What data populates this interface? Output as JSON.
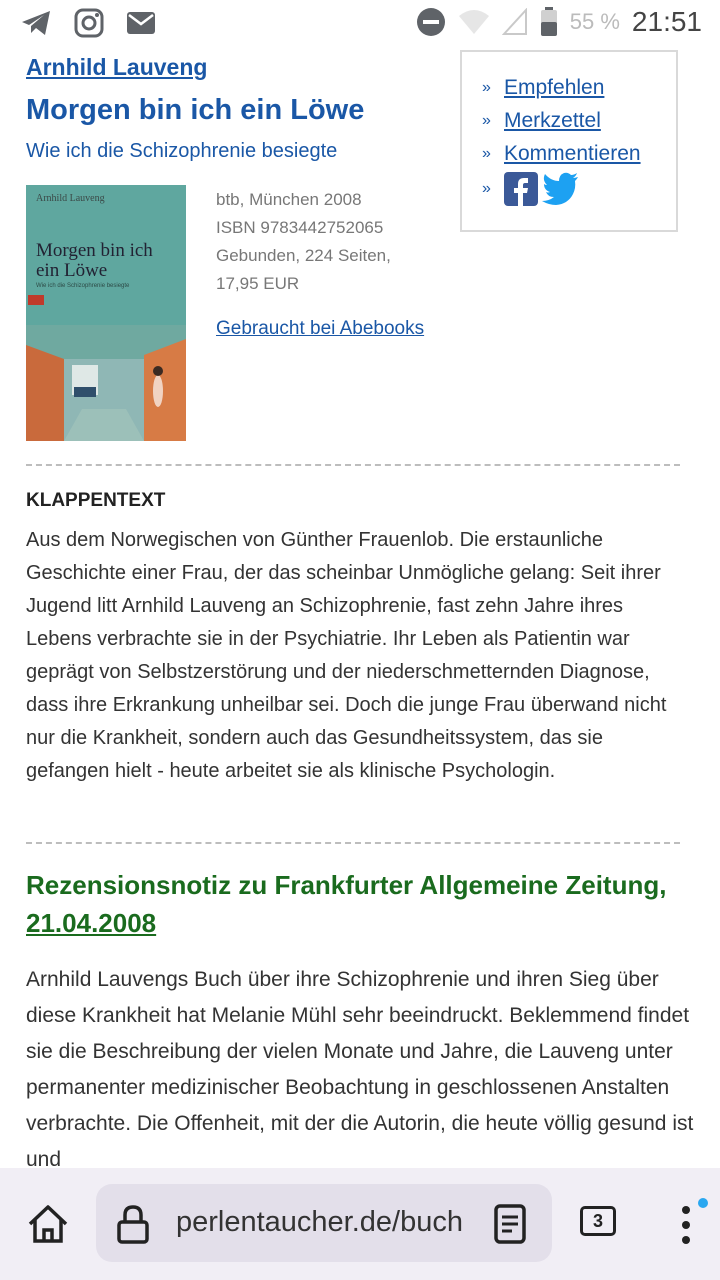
{
  "status_bar": {
    "time": "21:51",
    "battery_percent": "55 %",
    "icons": [
      "telegram-icon",
      "instagram-icon",
      "mail-icon",
      "do-not-disturb-icon",
      "wifi-icon",
      "signal-icon",
      "battery-icon"
    ]
  },
  "book": {
    "author": "Arnhild Lauveng",
    "title": "Morgen bin ich ein Löwe",
    "subtitle": "Wie ich die Schizophrenie besiegte",
    "meta": [
      "btb, München 2008",
      "ISBN 9783442752065",
      "Gebunden, 224 Seiten,",
      "17,95 EUR"
    ],
    "used_link": "Gebraucht bei Abebooks",
    "cover": {
      "author": "Arnhild Lauveng",
      "title_line1": "Morgen bin ich",
      "title_line2": "ein Löwe",
      "subtitle": "Wie ich die Schizophrenie besiegte"
    }
  },
  "actions": {
    "recommend": "Empfehlen",
    "notepad": "Merkzettel",
    "comment": "Kommentieren"
  },
  "blurb": {
    "heading": "KLAPPENTEXT",
    "text": "Aus dem Norwegischen von Günther Frauenlob. Die erstaunliche Geschichte einer Frau, der das scheinbar Unmögliche gelang: Seit ihrer Jugend litt Arnhild Lauveng an Schizophrenie, fast zehn Jahre ihres Lebens verbrachte sie in der Psychiatrie. Ihr Leben als Patientin war geprägt von Selbstzerstörung und der niederschmetternden Diagnose, dass ihre Erkrankung unheilbar sei. Doch die junge Frau überwand nicht nur die Krankheit, sondern auch das Gesundheitssystem, das sie gefangen hielt - heute arbeitet sie als klinische Psychologin."
  },
  "review": {
    "heading": "Rezensionsnotiz zu Frankfurter Allgemeine Zeitung,",
    "date": "21.04.2008",
    "text": "Arnhild Lauvengs Buch über ihre Schizophrenie und ihren Sieg über diese Krankheit hat Melanie Mühl sehr beeindruckt. Beklemmend findet sie die Beschreibung der vielen Monate und Jahre, die Lauveng unter permanenter medizinischer Beobachtung in geschlossenen Anstalten verbrachte. Die Offenheit, mit der die Autorin, die heute völlig gesund ist und"
  },
  "browser": {
    "url": "perlentaucher.de/buch",
    "tab_count": "3"
  },
  "colors": {
    "link_blue": "#1a57a6",
    "review_green": "#1a6b1e",
    "cover_teal": "#5fa79f",
    "bottom_bar": "#f1eef5"
  }
}
